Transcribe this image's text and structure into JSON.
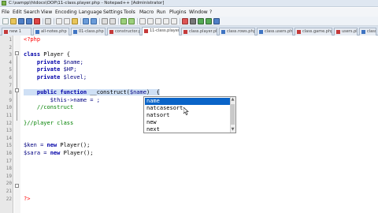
{
  "window": {
    "title": "C:\\xampp\\htdocs\\OOP\\11-class.player.php - Notepad++ [Administrator]"
  },
  "menu": [
    "File",
    "Edit",
    "Search",
    "View",
    "Encoding",
    "Language",
    "Settings",
    "Tools",
    "Macro",
    "Run",
    "Plugins",
    "Window",
    "?"
  ],
  "tabs": [
    "new 1",
    "all-notes.php",
    "01-class.php",
    "constructor.php",
    "11-class.player",
    "class.player.php",
    "class.rows.php",
    "class.users.php",
    "class.game.php",
    "users.php",
    "class.connect.php"
  ],
  "editor": {
    "line_numbers": [
      "1",
      "2",
      "3",
      "4",
      "5",
      "6",
      "7",
      "8",
      "9",
      "10",
      "11",
      "12",
      "13",
      "14",
      "15",
      "16",
      "17",
      "18",
      "19",
      "20",
      "21",
      "22"
    ],
    "lines": [
      {
        "parts": [
          {
            "t": "<?php",
            "c": "php"
          }
        ]
      },
      {
        "parts": []
      },
      {
        "parts": [
          {
            "t": "class ",
            "c": "kw"
          },
          {
            "t": "Player {",
            "c": "cls"
          }
        ]
      },
      {
        "parts": [
          {
            "t": "    private ",
            "c": "kw"
          },
          {
            "t": "$name;",
            "c": "var"
          }
        ]
      },
      {
        "parts": [
          {
            "t": "    private ",
            "c": "kw"
          },
          {
            "t": "$HP;",
            "c": "var"
          }
        ]
      },
      {
        "parts": [
          {
            "t": "    private ",
            "c": "kw"
          },
          {
            "t": "$level;",
            "c": "var"
          }
        ]
      },
      {
        "parts": []
      },
      {
        "parts": [
          {
            "t": "    public function ",
            "c": "kw"
          },
          {
            "t": "__construct(",
            "c": "plain"
          },
          {
            "t": "$name",
            "c": "var"
          },
          {
            "t": ")  {",
            "c": "plain"
          }
        ]
      },
      {
        "parts": [
          {
            "t": "        $this->name = ;",
            "c": "var"
          }
        ]
      },
      {
        "parts": [
          {
            "t": "    //construct",
            "c": "comment"
          }
        ]
      },
      {
        "parts": []
      },
      {
        "parts": [
          {
            "t": "}//player class",
            "c": "comment"
          }
        ]
      },
      {
        "parts": []
      },
      {
        "parts": []
      },
      {
        "parts": [
          {
            "t": "$ken = ",
            "c": "var"
          },
          {
            "t": "new ",
            "c": "kw"
          },
          {
            "t": "Player();",
            "c": "plain"
          }
        ]
      },
      {
        "parts": [
          {
            "t": "$sara = ",
            "c": "var"
          },
          {
            "t": "new ",
            "c": "kw"
          },
          {
            "t": "Player();",
            "c": "plain"
          }
        ]
      },
      {
        "parts": []
      },
      {
        "parts": []
      },
      {
        "parts": []
      },
      {
        "parts": []
      },
      {
        "parts": []
      },
      {
        "parts": [
          {
            "t": "?>",
            "c": "php"
          }
        ]
      }
    ]
  },
  "autocomplete": {
    "options": [
      "name",
      "natcasesort",
      "natsort",
      "new",
      "next"
    ],
    "selected": "name"
  },
  "colors": {
    "keyword": "#0000a8",
    "variable": "#000080",
    "comment": "#008000",
    "php_tag": "#ff0000",
    "selection": "#0a64c8"
  }
}
